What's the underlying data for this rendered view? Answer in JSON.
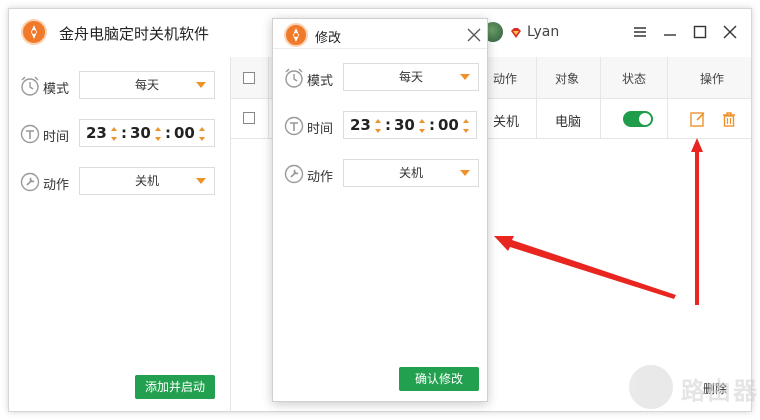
{
  "app": {
    "title": "金舟电脑定时关机软件",
    "username": "Lyan"
  },
  "left_form": {
    "mode_label": "模式",
    "mode_value": "每天",
    "time_label": "时间",
    "time_hour": "23",
    "time_minute": "30",
    "time_second": "00",
    "action_label": "动作",
    "action_value": "关机",
    "add_button": "添加并启动"
  },
  "table": {
    "headers": [
      "动作",
      "对象",
      "状态",
      "操作"
    ],
    "rows": [
      {
        "action": "关机",
        "target": "电脑",
        "enabled": true
      }
    ],
    "delete_button": "删除"
  },
  "dialog": {
    "title": "修改",
    "mode_label": "模式",
    "mode_value": "每天",
    "time_label": "时间",
    "time_hour": "23",
    "time_minute": "30",
    "time_second": "00",
    "action_label": "动作",
    "action_value": "关机",
    "confirm_button": "确认修改"
  },
  "watermark": {
    "text": "路由器"
  },
  "colors": {
    "accent": "#f07a2a",
    "green": "#23a04f",
    "arrow_red": "#e8261f",
    "edit_icon": "#f0922a"
  }
}
